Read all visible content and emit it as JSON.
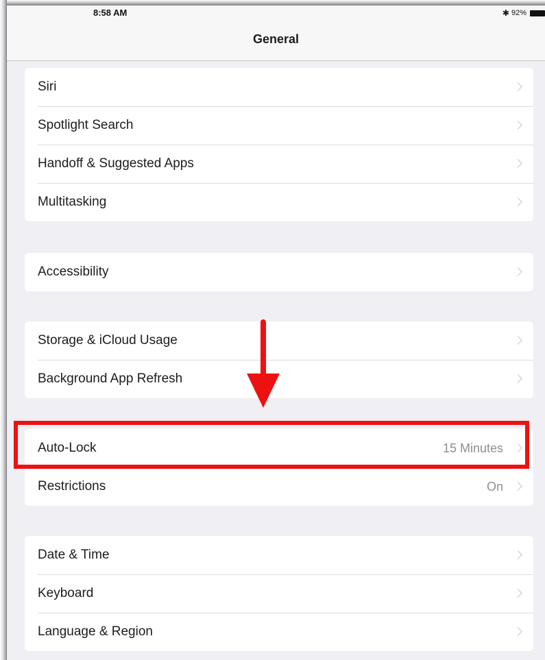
{
  "status_bar": {
    "time": "8:58 AM",
    "battery_percent": "92%",
    "icons": [
      "bluetooth-icon",
      "battery-icon"
    ]
  },
  "nav": {
    "title": "General"
  },
  "groups": [
    {
      "rows": [
        {
          "label": "Siri"
        },
        {
          "label": "Spotlight Search"
        },
        {
          "label": "Handoff & Suggested Apps"
        },
        {
          "label": "Multitasking"
        }
      ]
    },
    {
      "rows": [
        {
          "label": "Accessibility"
        }
      ]
    },
    {
      "rows": [
        {
          "label": "Storage & iCloud Usage"
        },
        {
          "label": "Background App Refresh"
        }
      ]
    },
    {
      "rows": [
        {
          "label": "Auto-Lock",
          "value": "15 Minutes"
        },
        {
          "label": "Restrictions",
          "value": "On"
        }
      ]
    },
    {
      "rows": [
        {
          "label": "Date & Time"
        },
        {
          "label": "Keyboard"
        },
        {
          "label": "Language & Region"
        }
      ]
    }
  ],
  "annotation": {
    "color": "#ee1111",
    "highlighted_row": "Auto-Lock"
  }
}
